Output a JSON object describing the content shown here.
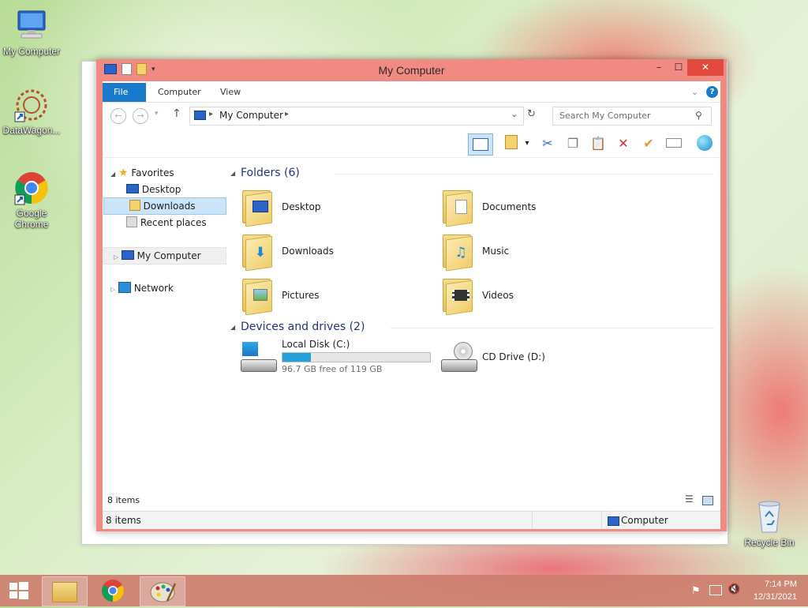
{
  "desktop": {
    "icons": [
      {
        "label": "My Computer"
      },
      {
        "label": "DataWagon..."
      },
      {
        "label": "Google Chrome"
      },
      {
        "label": "Recycle Bin"
      }
    ]
  },
  "window": {
    "title": "My Computer",
    "controls": {
      "minimize": "–",
      "maximize": "☐",
      "close": "✕"
    },
    "ribbon_tabs": [
      "File",
      "Computer",
      "View"
    ],
    "address": {
      "path": [
        "My Computer"
      ],
      "path_label": "My Computer"
    },
    "search": {
      "placeholder": "Search My Computer"
    },
    "nav": {
      "favorites_label": "Favorites",
      "favorites": [
        "Desktop",
        "Downloads",
        "Recent places"
      ],
      "selected": "Downloads",
      "computer_label": "My Computer",
      "network_label": "Network"
    },
    "groups": {
      "folders_header": "Folders (6)",
      "folders": [
        {
          "name": "Desktop",
          "emblem": "desktop-icon"
        },
        {
          "name": "Documents",
          "emblem": "document-icon"
        },
        {
          "name": "Downloads",
          "emblem": "download-arrow-icon"
        },
        {
          "name": "Music",
          "emblem": "music-note-icon"
        },
        {
          "name": "Pictures",
          "emblem": "picture-icon"
        },
        {
          "name": "Videos",
          "emblem": "film-icon"
        }
      ],
      "devices_header": "Devices and drives (2)",
      "drives": [
        {
          "name": "Local Disk (C:)",
          "free_text": "96.7 GB free of 119 GB",
          "used_fraction": 0.19
        },
        {
          "name": "CD Drive (D:)"
        }
      ]
    },
    "status_inner": "8 items",
    "status_outer": "8 items",
    "status_location": "Computer"
  },
  "taskbar": {
    "time": "7:14 PM",
    "date": "12/31/2021"
  },
  "colors": {
    "accent": "#1979ca",
    "frame": "#f08a82",
    "close": "#e04a3f",
    "drive_bar": "#26a0da"
  }
}
